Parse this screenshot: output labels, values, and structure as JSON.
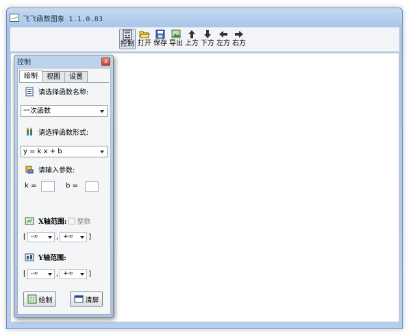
{
  "app": {
    "title": "飞飞函数图象 1.1.0.83"
  },
  "toolbar": {
    "items": [
      {
        "label": "控制",
        "icon": "control-icon"
      },
      {
        "label": "打开",
        "icon": "folder-open-icon"
      },
      {
        "label": "保存",
        "icon": "save-disk-icon"
      },
      {
        "label": "导出",
        "icon": "export-image-icon"
      },
      {
        "label": "上方",
        "icon": "arrow-up-icon"
      },
      {
        "label": "下方",
        "icon": "arrow-down-icon"
      },
      {
        "label": "左方",
        "icon": "arrow-left-icon"
      },
      {
        "label": "右方",
        "icon": "arrow-right-icon"
      }
    ]
  },
  "panel": {
    "title": "控制",
    "close": "x",
    "tabs": [
      "绘制",
      "视图",
      "设置"
    ],
    "func_name_label": "请选择函数名称:",
    "func_name_value": "一次函数",
    "func_form_label": "请选择函数形式:",
    "func_form_value": "y = k x + b",
    "params_label": "请输入参数:",
    "param_k": "k =",
    "param_b": "b =",
    "x_range_label": "X轴范围:",
    "integer_label": "整数",
    "y_range_label": "Y轴范围:",
    "bracket_open": "[",
    "bracket_close": "]",
    "comma": ",",
    "x_min": "-∞",
    "x_max": "+∞",
    "y_min": "-∞",
    "y_max": "+∞",
    "draw_button": "绘制",
    "clear_button": "清屏"
  }
}
